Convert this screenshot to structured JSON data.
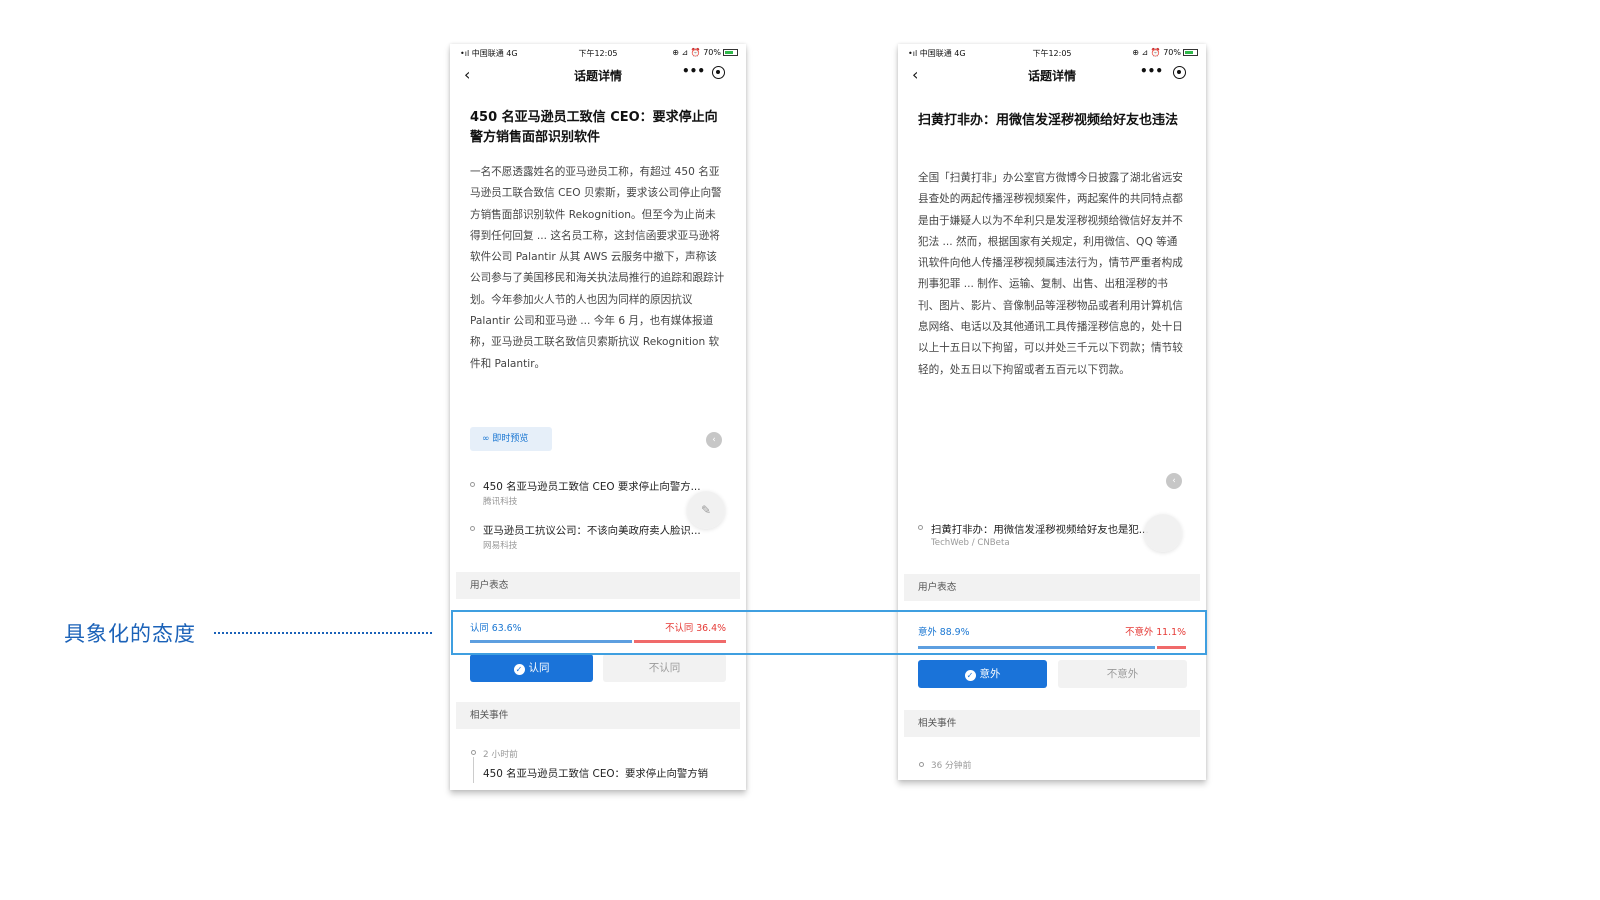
{
  "annotation": {
    "label": "具象化的态度"
  },
  "phone1": {
    "status": {
      "carrier": "•ıl 中国联通  4G",
      "time": "下午12:05",
      "right": "⊕ ⊿ ⏰ 70%"
    },
    "nav": {
      "back": "‹",
      "title": "话题详情",
      "more": "•••"
    },
    "title": "450 名亚马逊员工致信 CEO：要求停止向警方销售面部识别软件",
    "body": "一名不愿透露姓名的亚马逊员工称，有超过 450 名亚马逊员工联合致信 CEO 贝索斯，要求该公司停止向警方销售面部识别软件 Rekognition。但至今为止尚未得到任何回复 ... 这名员工称，这封信函要求亚马逊将软件公司 Palantir 从其 AWS 云服务中撤下，声称该公司参与了美国移民和海关执法局推行的追踪和跟踪计划。今年参加火人节的人也因为同样的原因抗议 Palantir 公司和亚马逊 ... 今年 6 月，也有媒体报道称，亚马逊员工联名致信贝索斯抗议 Rekognition 软件和 Palantir。",
    "preview_chip": "∞ 即时预览",
    "share_icon": "share-icon",
    "news": [
      {
        "title": "450 名亚马逊员工致信 CEO 要求停止向警方...",
        "source": "腾讯科技"
      },
      {
        "title": "亚马逊员工抗议公司：不该向美政府卖人脸识...",
        "source": "网易科技"
      }
    ],
    "fab_icon": "edit-icon",
    "opinion_header": "用户表态",
    "vote": {
      "yes_label": "认同 63.6%",
      "no_label": "不认同 36.4%",
      "yes_fraction": 0.636,
      "no_fraction": 0.364
    },
    "btn_yes": "认同",
    "btn_no": "不认同",
    "related_header": "相关事件",
    "timeline": {
      "time": "2 小时前",
      "title": "450 名亚马逊员工致信 CEO：要求停止向警方销"
    }
  },
  "phone2": {
    "status": {
      "carrier": "•ıl 中国联通  4G",
      "time": "下午12:05",
      "right": "⊕ ⊿ ⏰ 70%"
    },
    "nav": {
      "back": "‹",
      "title": "话题详情",
      "more": "•••"
    },
    "title": "扫黄打非办：用微信发淫秽视频给好友也违法",
    "body": "全国「扫黄打非」办公室官方微博今日披露了湖北省远安县查处的两起传播淫秽视频案件，两起案件的共同特点都是由于嫌疑人以为不牟利只是发淫秽视频给微信好友并不犯法 ... 然而，根据国家有关规定，利用微信、QQ 等通讯软件向他人传播淫秽视频属违法行为，情节严重者构成刑事犯罪 ... 制作、运输、复制、出售、出租淫秽的书刊、图片、影片、音像制品等淫秽物品或者利用计算机信息网络、电话以及其他通讯工具传播淫秽信息的，处十日以上十五日以下拘留，可以并处三千元以下罚款；情节较轻的，处五日以下拘留或者五百元以下罚款。",
    "share_icon": "share-icon",
    "news": [
      {
        "title": "扫黄打非办：用微信发淫秽视频给好友也是犯...",
        "source": "TechWeb / CNBeta"
      }
    ],
    "opinion_header": "用户表态",
    "vote": {
      "yes_label": "意外 88.9%",
      "no_label": "不意外 11.1%",
      "yes_fraction": 0.889,
      "no_fraction": 0.111
    },
    "btn_yes": "意外",
    "btn_no": "不意外",
    "related_header": "相关事件",
    "timeline": {
      "time": "36 分钟前"
    }
  }
}
